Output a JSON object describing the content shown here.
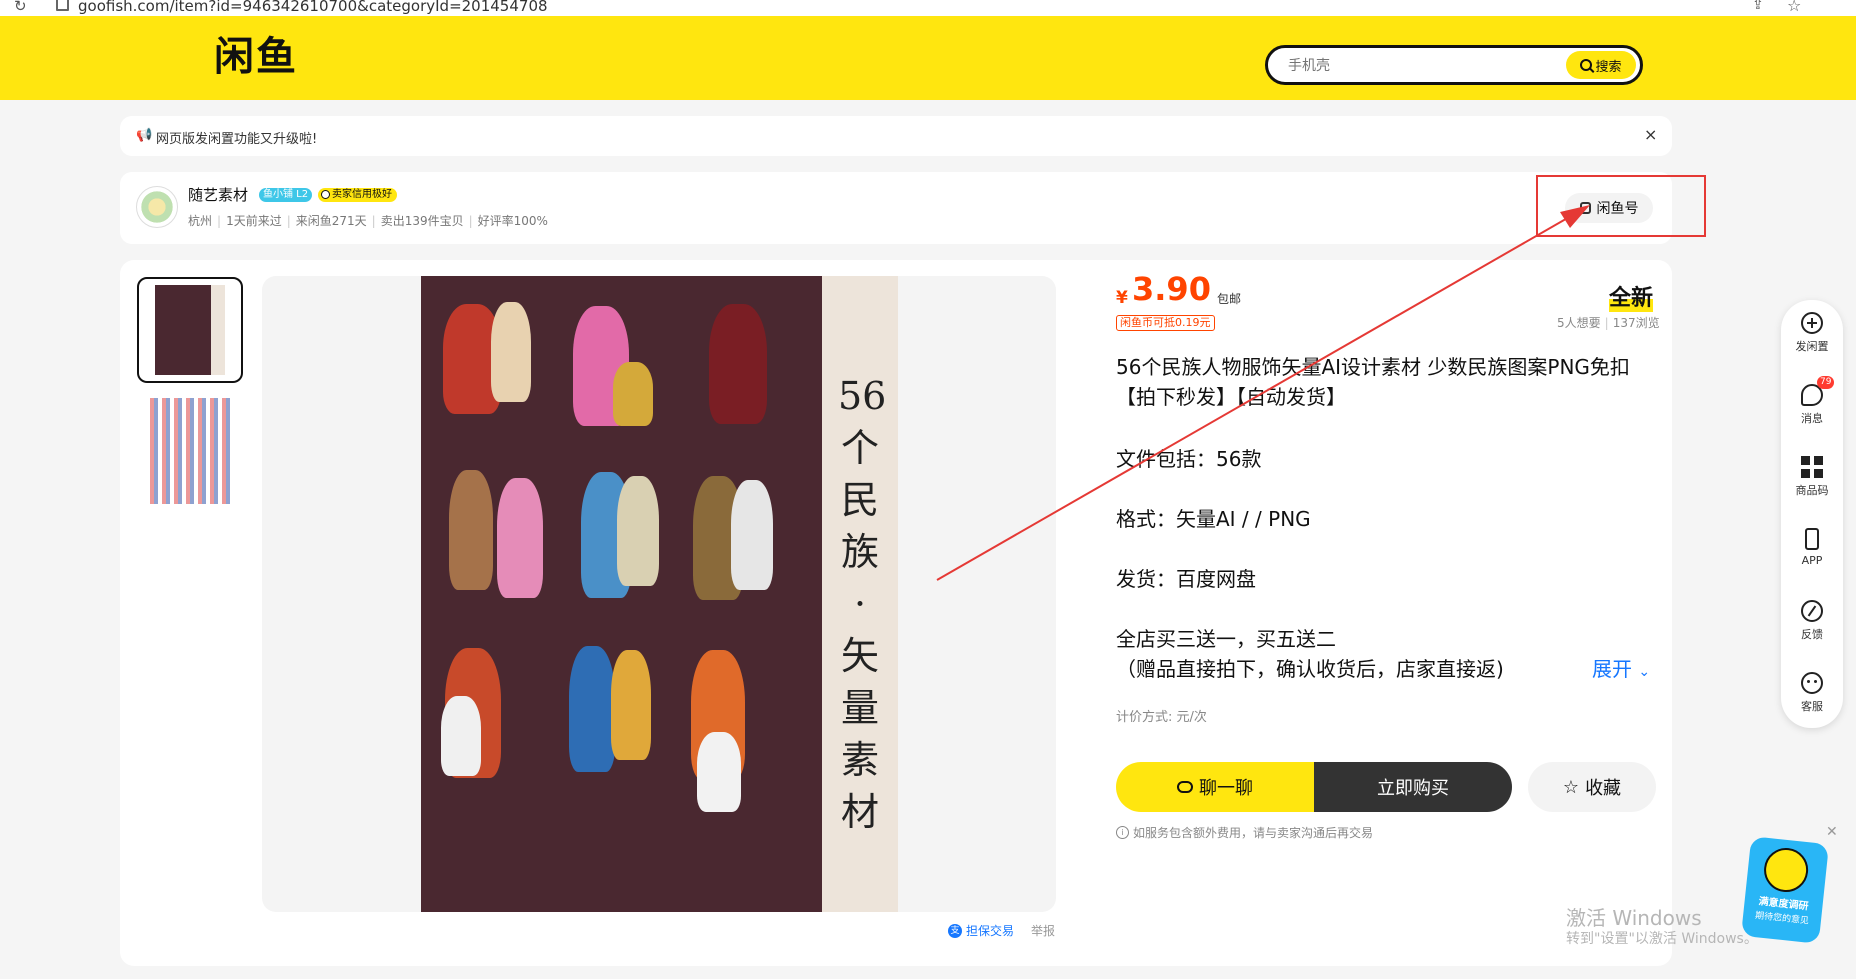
{
  "browser": {
    "url": "goofish.com/item?id=946342610700&categoryId=201454708"
  },
  "header": {
    "logo": "闲鱼",
    "search_placeholder": "手机壳",
    "search_button": "搜索"
  },
  "notice": {
    "text": "网页版发闲置功能又升级啦!",
    "close": "×"
  },
  "seller": {
    "name": "随艺素材",
    "level_badge": "鱼小铺 L2",
    "credit_badge": "卖家信用极好",
    "location": "杭州",
    "last_visit": "1天前来过",
    "days_on_platform": "来闲鱼271天",
    "sold": "卖出139件宝贝",
    "rating": "好评率100%",
    "xianyu_id_button": "闲鱼号"
  },
  "poster": {
    "vertical_title": [
      "56",
      "个",
      "民",
      "族",
      "·",
      "矢",
      "量",
      "素",
      "材"
    ]
  },
  "image_footer": {
    "guarantee": "担保交易",
    "report": "举报"
  },
  "product": {
    "currency": "¥",
    "price": "3.90",
    "shipping": "包邮",
    "coin_offset": "闲鱼币可抵0.19元",
    "condition": "全新",
    "wants": "5人想要",
    "views": "137浏览",
    "title": "56个民族人物服饰矢量AI设计素材 少数民族图案PNG免扣 【拍下秒发】【自动发货】",
    "desc": [
      "文件包括：56款",
      "格式：矢量AI / / PNG",
      "发货：百度网盘",
      "全店买三送一，买五送二",
      "（赠品直接拍下，确认收货后，店家直接返)"
    ],
    "expand": "展开",
    "pricing_unit": "计价方式: 元/次",
    "chat_button": "聊一聊",
    "buy_button": "立即购买",
    "fav_button": "收藏",
    "note": "如服务包含额外费用，请与卖家沟通后再交易"
  },
  "floatbar": {
    "items": [
      {
        "label": "发闲置"
      },
      {
        "label": "消息",
        "badge": "79"
      },
      {
        "label": "商品码"
      },
      {
        "label": "APP"
      },
      {
        "label": "反馈"
      },
      {
        "label": "客服"
      }
    ]
  },
  "survey": {
    "label": "满意度调研",
    "sub": "期待您的意见"
  },
  "watermark": {
    "line1": "激活 Windows",
    "line2": "转到\"设置\"以激活 Windows。"
  },
  "colors": {
    "brand_yellow": "#ffe60f",
    "price_orange": "#ff4400",
    "link_blue": "#1677ff",
    "annotation_red": "#e53935"
  }
}
